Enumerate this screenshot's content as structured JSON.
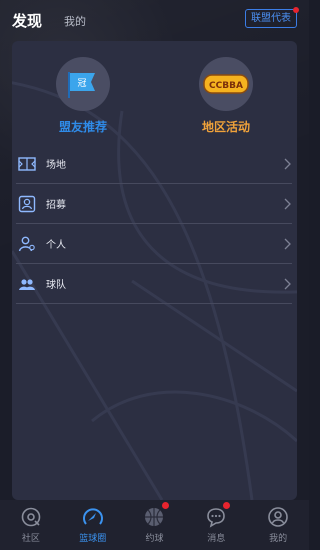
{
  "header": {
    "tab_active": "发现",
    "tab_inactive": "我的",
    "league_button": "联盟代表"
  },
  "features": {
    "recommend_label": "盟友推荐",
    "recommend_flag_text": "冠",
    "region_label": "地区活动",
    "region_logo_text": "CCBBA"
  },
  "menu": {
    "items": [
      {
        "label": "场地",
        "icon": "court-icon"
      },
      {
        "label": "招募",
        "icon": "recruit-icon"
      },
      {
        "label": "个人",
        "icon": "person-icon"
      },
      {
        "label": "球队",
        "icon": "team-icon"
      }
    ]
  },
  "bottom_nav": {
    "items": [
      {
        "label": "社区",
        "icon": "community-icon"
      },
      {
        "label": "篮球圈",
        "icon": "basketball-circle-icon"
      },
      {
        "label": "约球",
        "icon": "basketball-icon"
      },
      {
        "label": "消息",
        "icon": "message-icon"
      },
      {
        "label": "我的",
        "icon": "profile-icon"
      }
    ],
    "active_index": 1
  },
  "colors": {
    "accent_blue": "#3b93f0",
    "accent_orange": "#f0a23a",
    "badge_red": "#e7242e"
  }
}
